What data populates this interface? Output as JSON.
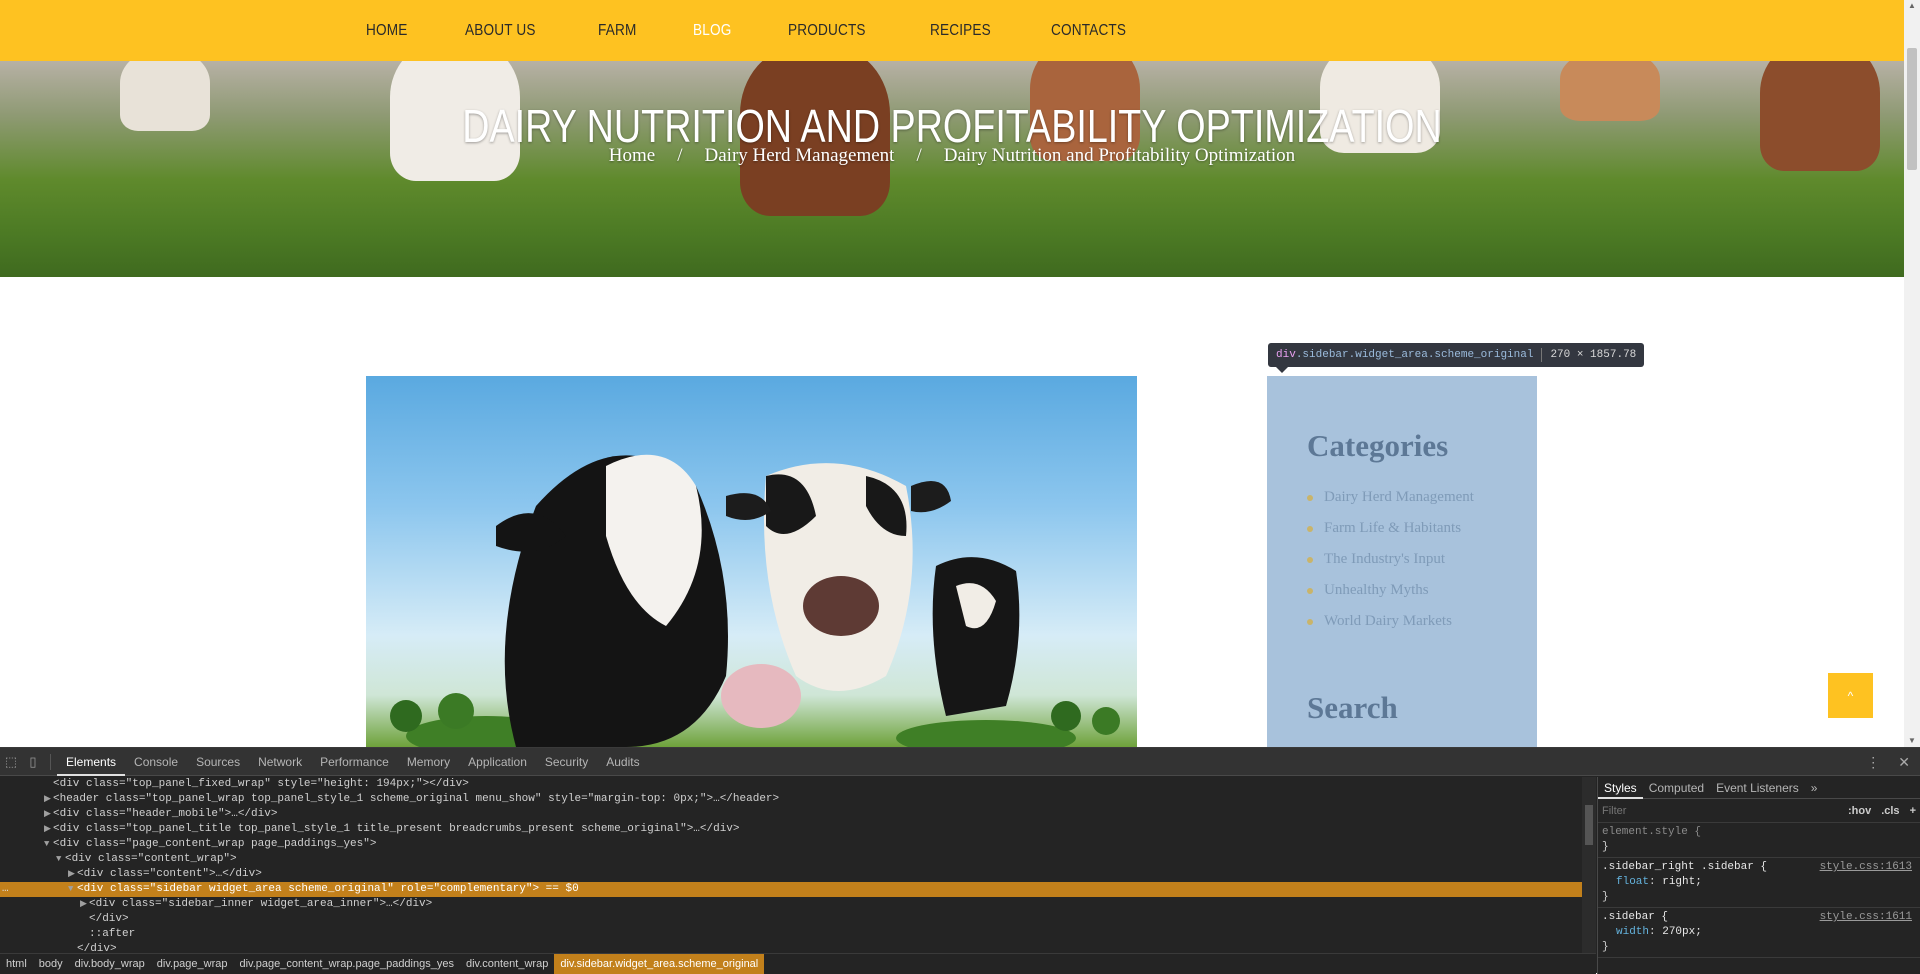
{
  "nav": {
    "items": [
      "HOME",
      "ABOUT US",
      "FARM",
      "BLOG",
      "PRODUCTS",
      "RECIPES",
      "CONTACTS"
    ],
    "active_index": 3
  },
  "hero": {
    "title": "DAIRY NUTRITION AND PROFITABILITY OPTIMIZATION",
    "breadcrumbs": [
      "Home",
      "Dairy Herd Management",
      "Dairy Nutrition and Profitability Optimization"
    ],
    "separator": "/"
  },
  "sidebar": {
    "categories_title": "Categories",
    "categories": [
      "Dairy Herd Management",
      "Farm Life & Habitants",
      "The Industry's Input",
      "Unhealthy Myths",
      "World Dairy Markets"
    ],
    "search_title": "Search"
  },
  "inspect_tooltip": {
    "tag": "div",
    "classes": ".sidebar.widget_area.scheme_original",
    "size": "270 × 1857.78"
  },
  "to_top": {
    "icon": "chevron-up-icon",
    "glyph": "^"
  },
  "colors": {
    "brand_yellow": "#fec221",
    "sidebar_bg": "#a8c2dc",
    "devtools_highlight": "#c2801b"
  },
  "devtools": {
    "tabs": [
      "Elements",
      "Console",
      "Sources",
      "Network",
      "Performance",
      "Memory",
      "Application",
      "Security",
      "Audits"
    ],
    "active_tab": "Elements",
    "dom_lines": [
      {
        "indent": 0,
        "tri": "",
        "text": "<div class=\"top_panel_fixed_wrap\" style=\"height: 194px;\"></div>"
      },
      {
        "indent": 0,
        "tri": "▶",
        "text": "<header class=\"top_panel_wrap top_panel_style_1 scheme_original menu_show\" style=\"margin-top: 0px;\">…</header>"
      },
      {
        "indent": 0,
        "tri": "▶",
        "text": "<div class=\"header_mobile\">…</div>"
      },
      {
        "indent": 0,
        "tri": "▶",
        "text": "<div class=\"top_panel_title top_panel_style_1 title_present breadcrumbs_present scheme_original\">…</div>"
      },
      {
        "indent": 0,
        "tri": "▼",
        "text": "<div class=\"page_content_wrap page_paddings_yes\">"
      },
      {
        "indent": 1,
        "tri": "▼",
        "text": "<div class=\"content_wrap\">"
      },
      {
        "indent": 2,
        "tri": "▶",
        "text": "<div class=\"content\">…</div>"
      },
      {
        "indent": 2,
        "tri": "▼",
        "text": "<div class=\"sidebar widget_area scheme_original\" role=\"complementary\"> == $0",
        "selected": true
      },
      {
        "indent": 3,
        "tri": "▶",
        "text": "<div class=\"sidebar_inner widget_area_inner\">…</div>"
      },
      {
        "indent": 3,
        "tri": "",
        "text": "</div>"
      },
      {
        "indent": 3,
        "tri": "",
        "text": "::after"
      },
      {
        "indent": 2,
        "tri": "",
        "text": "</div>"
      }
    ],
    "breadcrumbs": [
      "html",
      "body",
      "div.body_wrap",
      "div.page_wrap",
      "div.page_content_wrap.page_paddings_yes",
      "div.content_wrap",
      "div.sidebar.widget_area.scheme_original"
    ],
    "styles_tabs": [
      "Styles",
      "Computed",
      "Event Listeners",
      "»"
    ],
    "filter_placeholder": "Filter",
    "filter_buttons": [
      ":hov",
      ".cls",
      "+"
    ],
    "rules": [
      {
        "selector": "element.style {",
        "source": "",
        "props": [],
        "close": "}"
      },
      {
        "selector": ".sidebar_right .sidebar {",
        "source": "style.css:1613",
        "props": [
          {
            "name": "float",
            "value": "right;"
          }
        ],
        "close": "}"
      },
      {
        "selector": ".sidebar {",
        "source": "style.css:1611",
        "props": [
          {
            "name": "width",
            "value": "270px;"
          }
        ],
        "close": "}"
      }
    ]
  }
}
